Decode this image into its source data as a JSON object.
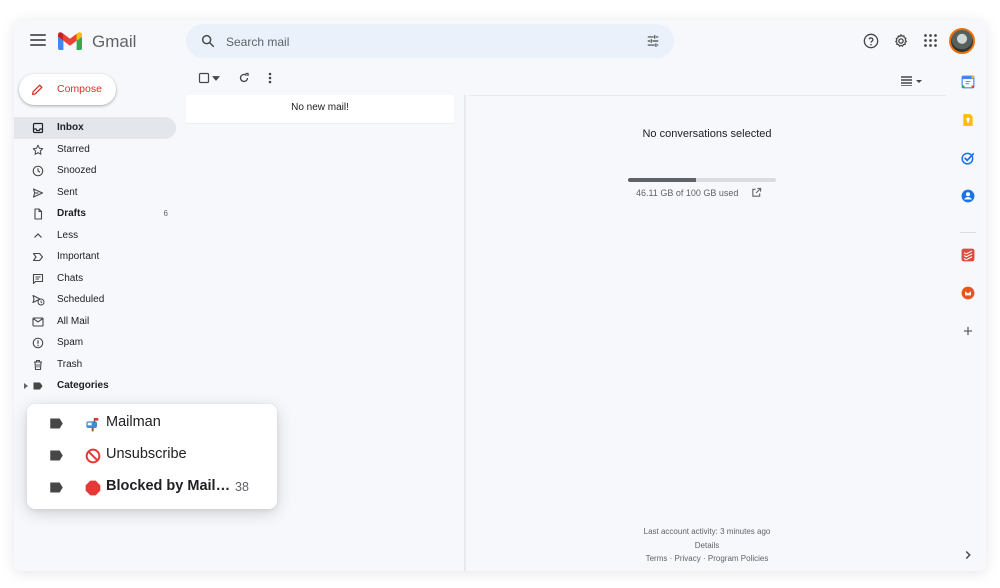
{
  "app": {
    "name": "Gmail"
  },
  "search": {
    "placeholder": "Search mail"
  },
  "compose": {
    "label": "Compose"
  },
  "sidebar": {
    "items": [
      {
        "label": "Inbox",
        "bold": true,
        "active": true,
        "icon": "inbox-icon"
      },
      {
        "label": "Starred",
        "icon": "star-icon"
      },
      {
        "label": "Snoozed",
        "icon": "clock-icon"
      },
      {
        "label": "Sent",
        "icon": "send-icon"
      },
      {
        "label": "Drafts",
        "bold": true,
        "count": "6",
        "icon": "draft-icon"
      },
      {
        "label": "Less",
        "icon": "chevron-up-icon"
      },
      {
        "label": "Important",
        "icon": "important-icon"
      },
      {
        "label": "Chats",
        "icon": "chat-icon"
      },
      {
        "label": "Scheduled",
        "icon": "scheduled-icon"
      },
      {
        "label": "All Mail",
        "icon": "mail-icon"
      },
      {
        "label": "Spam",
        "icon": "spam-icon"
      },
      {
        "label": "Trash",
        "icon": "trash-icon"
      },
      {
        "label": "Categories",
        "bold": true,
        "icon": "label-icon"
      }
    ]
  },
  "list": {
    "empty_text": "No new mail!"
  },
  "reading": {
    "empty_text": "No conversations selected",
    "storage": {
      "text": "46.11 GB of 100 GB used",
      "used_fraction": 0.4611
    }
  },
  "footer": {
    "activity": "Last account activity: 3 minutes ago",
    "details": "Details",
    "terms": "Terms",
    "privacy": "Privacy",
    "policies": "Program Policies",
    "separator": "·"
  },
  "label_popup": {
    "items": [
      {
        "label": "Mailman",
        "emoji": "mailbox-icon"
      },
      {
        "label": "Unsubscribe",
        "emoji": "prohibited-icon"
      },
      {
        "label": "Blocked by Mail…",
        "emoji": "stop-sign-icon",
        "count": "38",
        "bold": true
      }
    ]
  },
  "colors": {
    "accent_red": "#d93025",
    "background": "#f6f8fc",
    "search_bg": "#eaf1fb",
    "active_nav": "#e3e6eb"
  }
}
